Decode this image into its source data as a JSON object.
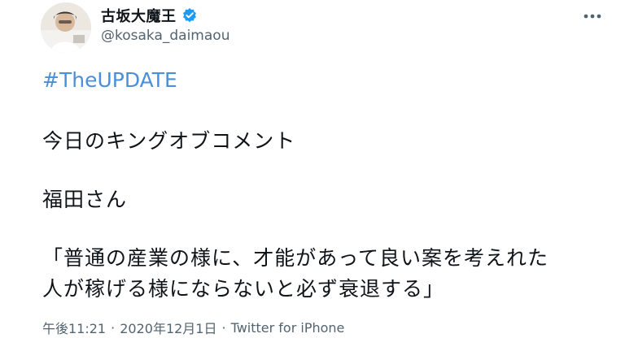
{
  "user": {
    "display_name": "古坂大魔王",
    "handle": "@kosaka_daimaou",
    "verified": true,
    "avatar_icon": "user-avatar-photo"
  },
  "menu": {
    "icon": "more-horizontal-icon"
  },
  "tweet": {
    "hashtag": "#TheUPDATE",
    "lines": [
      "今日のキングオブコメント",
      "福田さん",
      "「普通の産業の様に、才能があって良い案を考えれた",
      "人が稼げる様にならないと必ず衰退する」"
    ]
  },
  "meta": {
    "time": "午後11:21",
    "separator": "·",
    "date": "2020年12月1日",
    "source": "Twitter for iPhone"
  },
  "colors": {
    "hashtag": "#4a8fd8",
    "verified_badge": "#1d9bf0",
    "secondary_text": "#536471",
    "primary_text": "#0f1419"
  }
}
